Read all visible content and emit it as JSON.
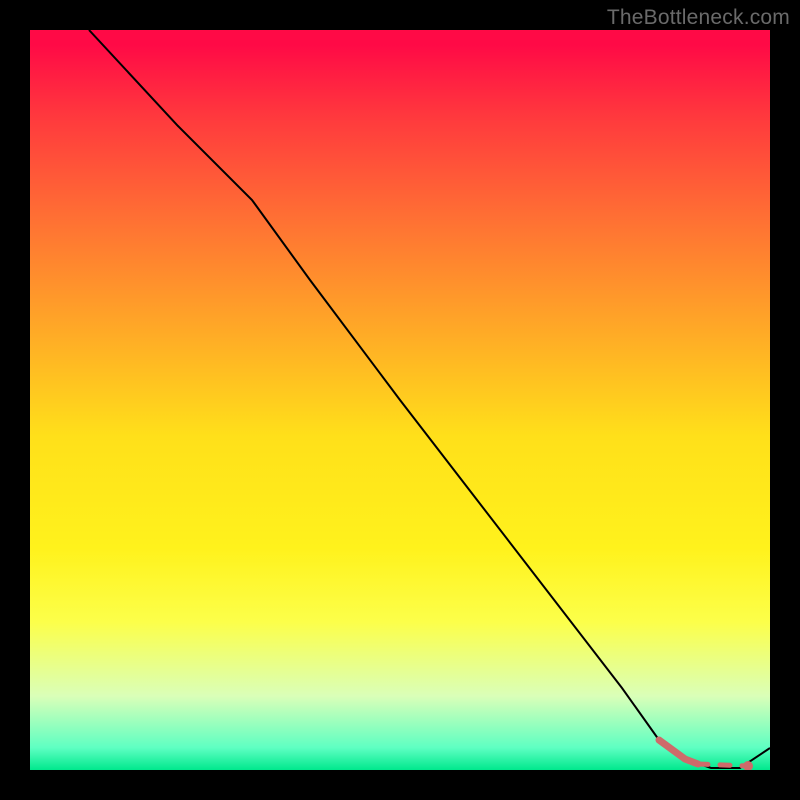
{
  "watermark": "TheBottleneck.com",
  "colors": {
    "curve": "#000000",
    "valley_highlight": "#ce6b6a",
    "gradient_top": "#ff0a46",
    "gradient_mid": "#ffe01a",
    "gradient_bottom": "#00e98d",
    "background": "#000000"
  },
  "chart_data": {
    "type": "line",
    "title": "",
    "xlabel": "",
    "ylabel": "",
    "xlim": [
      0,
      100
    ],
    "ylim": [
      0,
      100
    ],
    "grid": false,
    "legend": false,
    "series": [
      {
        "name": "bottleneck-curve",
        "x": [
          8,
          20,
          30,
          40,
          50,
          60,
          70,
          80,
          85,
          88,
          92,
          96,
          100
        ],
        "y": [
          100,
          87,
          77,
          64,
          50,
          37,
          24,
          11,
          4,
          1,
          0,
          0,
          3
        ]
      }
    ],
    "valley_highlight": {
      "x_range": [
        85,
        97
      ],
      "optimum_x": 97,
      "optimum_y": 0
    }
  }
}
